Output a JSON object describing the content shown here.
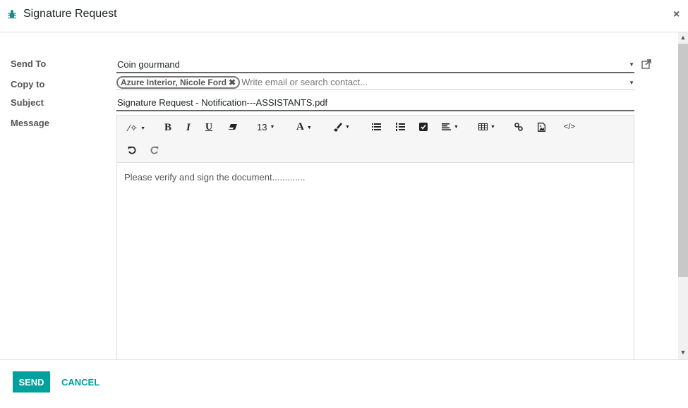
{
  "dialog": {
    "title": "Signature Request",
    "close_symbol": "×",
    "header_icon": "bug-icon"
  },
  "form": {
    "send_to": {
      "label": "Send To",
      "value": "Coin gourmand"
    },
    "copy_to": {
      "label": "Copy to",
      "tags": [
        "Azure Interior, Nicole Ford"
      ],
      "placeholder": "Write email or search contact..."
    },
    "subject": {
      "label": "Subject",
      "value": "Signature Request - Notification---ASSISTANTS.pdf"
    },
    "message": {
      "label": "Message",
      "body": "Please verify and sign the document............."
    }
  },
  "toolbar": {
    "font_size": "13",
    "bold": "B",
    "italic": "I",
    "underline": "U",
    "font_color": "A",
    "code": "</>"
  },
  "footer": {
    "send_label": "SEND",
    "cancel_label": "CANCEL"
  },
  "colors": {
    "accent": "#00a09d"
  }
}
